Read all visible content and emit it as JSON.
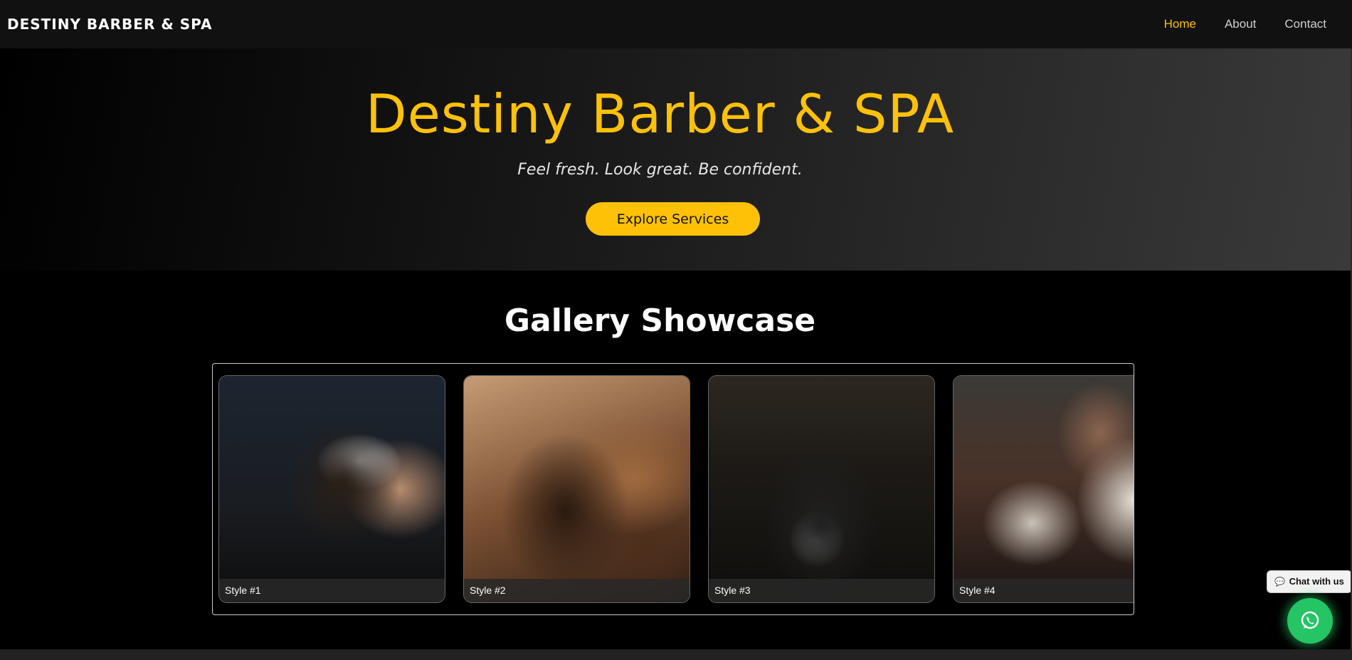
{
  "nav": {
    "brand": "DESTINY BARBER & SPA",
    "links": [
      {
        "label": "Home",
        "active": true
      },
      {
        "label": "About",
        "active": false
      },
      {
        "label": "Contact",
        "active": false
      }
    ]
  },
  "hero": {
    "title": "Destiny Barber & SPA",
    "tagline": "Feel fresh. Look great. Be confident.",
    "button_label": "Explore Services"
  },
  "gallery": {
    "title": "Gallery Showcase",
    "items": [
      {
        "caption": "Style #1"
      },
      {
        "caption": "Style #2"
      },
      {
        "caption": "Style #3"
      },
      {
        "caption": "Style #4"
      }
    ]
  },
  "chat": {
    "label": "Chat with us",
    "icon": "whatsapp-icon"
  },
  "colors": {
    "accent": "#ffc107",
    "whatsapp": "#25c464",
    "navbar": "#111111"
  }
}
